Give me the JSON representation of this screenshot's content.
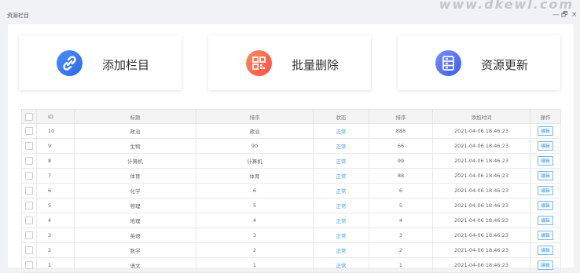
{
  "watermark": "www.dkewl.com",
  "window": {
    "title": "资源栏目",
    "controls": {
      "minimize": "—",
      "maximize": "🗗",
      "close": "×"
    }
  },
  "actions": [
    {
      "label": "添加栏目",
      "icon": "link-icon",
      "color": "#3a7bf5"
    },
    {
      "label": "批量删除",
      "icon": "qrcode-icon",
      "color": "#ff6a4a"
    },
    {
      "label": "资源更新",
      "icon": "server-icon",
      "color": "#4b6ef5"
    }
  ],
  "table": {
    "headers": [
      "",
      "ID",
      "标题",
      "排序",
      "状态",
      "排序",
      "添加时间",
      "操作"
    ],
    "rows": [
      {
        "id": "10",
        "title": "政治",
        "sort_name": "政治",
        "status": "正常",
        "order": "888",
        "time": "2021-04-06 18:46:23",
        "action": "编辑"
      },
      {
        "id": "9",
        "title": "生物",
        "sort_name": "90",
        "status": "正常",
        "order": "66",
        "time": "2021-04-06 18:46:23",
        "action": "编辑"
      },
      {
        "id": "8",
        "title": "计算机",
        "sort_name": "计算机",
        "status": "正常",
        "order": "99",
        "time": "2021-04-06 18:46:23",
        "action": "编辑"
      },
      {
        "id": "7",
        "title": "体育",
        "sort_name": "体育",
        "status": "正常",
        "order": "88",
        "time": "2021-04-06 18:46:23",
        "action": "编辑"
      },
      {
        "id": "6",
        "title": "化学",
        "sort_name": "6",
        "status": "正常",
        "order": "6",
        "time": "2021-04-06 18:46:23",
        "action": "编辑"
      },
      {
        "id": "5",
        "title": "物理",
        "sort_name": "5",
        "status": "正常",
        "order": "5",
        "time": "2021-04-06 18:46:23",
        "action": "编辑"
      },
      {
        "id": "4",
        "title": "地理",
        "sort_name": "4",
        "status": "正常",
        "order": "4",
        "time": "2021-04-06 18:46:23",
        "action": "编辑"
      },
      {
        "id": "3",
        "title": "英语",
        "sort_name": "3",
        "status": "正常",
        "order": "3",
        "time": "2021-04-06 18:46:23",
        "action": "编辑"
      },
      {
        "id": "2",
        "title": "数学",
        "sort_name": "2",
        "status": "正常",
        "order": "2",
        "time": "2021-04-06 18:46:23",
        "action": "编辑"
      },
      {
        "id": "1",
        "title": "语文",
        "sort_name": "1",
        "status": "正常",
        "order": "1",
        "time": "2021-04-06 18:46:23",
        "action": "编辑"
      }
    ]
  }
}
